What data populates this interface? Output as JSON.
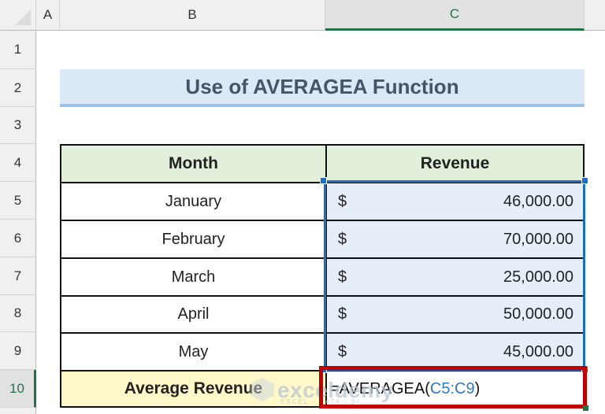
{
  "sheet": {
    "columns": [
      "A",
      "B",
      "C"
    ],
    "selected_column": "C",
    "rows": [
      "1",
      "2",
      "3",
      "4",
      "5",
      "6",
      "7",
      "8",
      "9",
      "10"
    ],
    "selected_row": "10"
  },
  "title": "Use of AVERAGEA Function",
  "table": {
    "headers": {
      "month": "Month",
      "revenue": "Revenue"
    },
    "currency_symbol": "$",
    "rows": [
      {
        "month": "January",
        "revenue": "46,000.00"
      },
      {
        "month": "February",
        "revenue": "70,000.00"
      },
      {
        "month": "March",
        "revenue": "25,000.00"
      },
      {
        "month": "April",
        "revenue": "50,000.00"
      },
      {
        "month": "May",
        "revenue": "45,000.00"
      }
    ],
    "average": {
      "label": "Average Revenue",
      "formula_prefix": "=AVERAGEA(",
      "formula_ref": "C5:C9",
      "formula_suffix": ")"
    }
  },
  "colors": {
    "selection": "#1a6fc4",
    "highlight_box": "#c00000",
    "excel_green": "#217346"
  },
  "watermark": {
    "text": "exceldemy",
    "subtext": "EXCEL · DATA · BI"
  }
}
